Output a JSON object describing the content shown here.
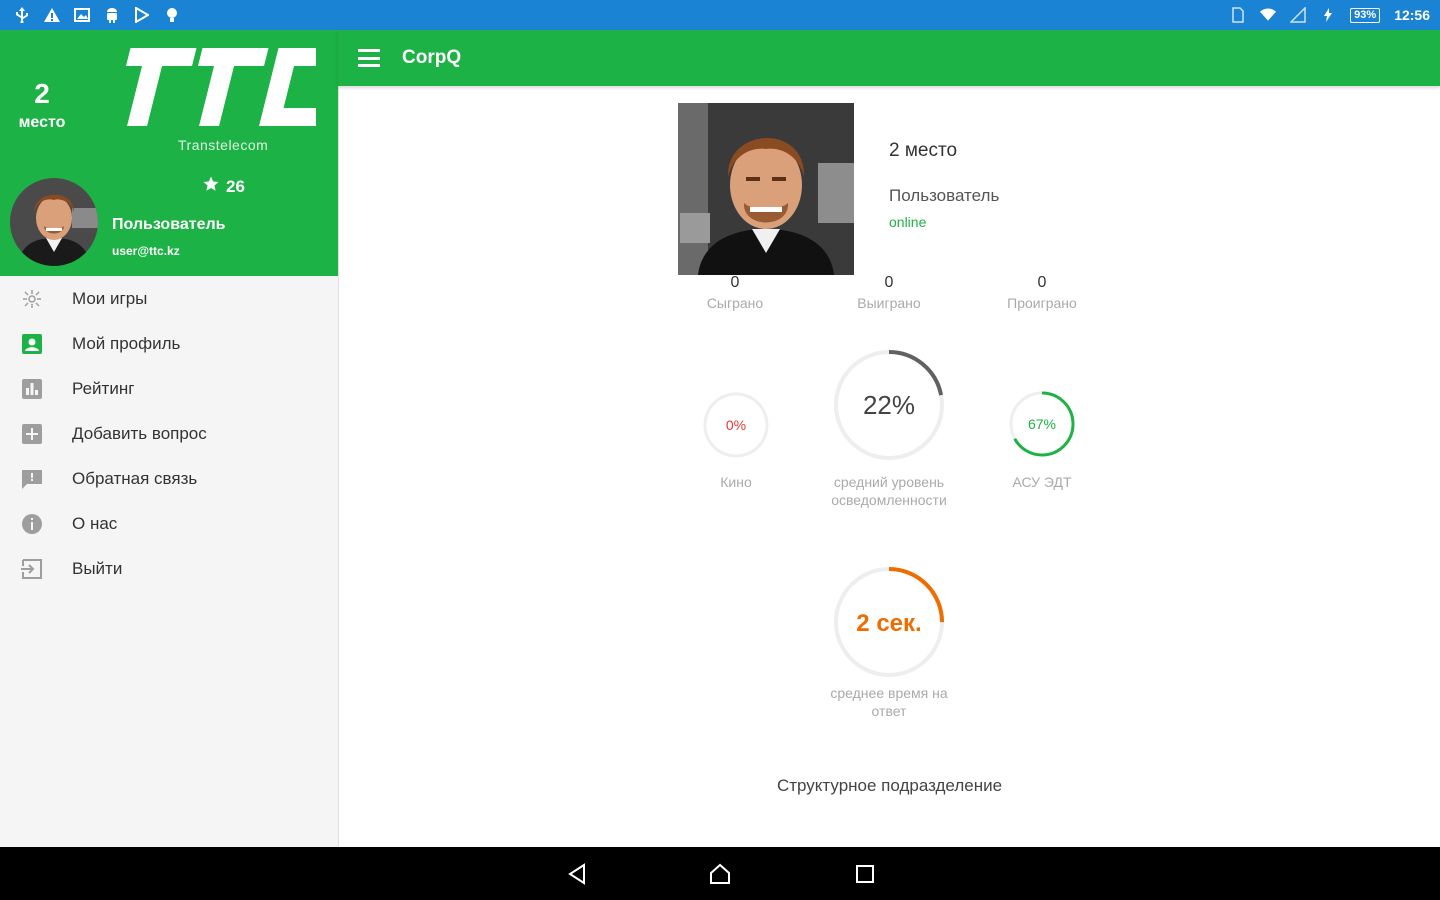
{
  "status_bar": {
    "battery": "93%",
    "time": "12:56",
    "color": "#1a83d4"
  },
  "app": {
    "title": "CorpQ",
    "accent": "#1db245"
  },
  "drawer": {
    "place_number": "2",
    "place_label": "место",
    "logo_subtitle": "Transtelecom",
    "logo_text": "TTC",
    "stars": "26",
    "user_name": "Пользователь",
    "user_email": "user@ttc.kz",
    "menu": [
      {
        "label": "Мои игры",
        "icon": "games-icon"
      },
      {
        "label": "Мой профиль",
        "icon": "profile-icon"
      },
      {
        "label": "Рейтинг",
        "icon": "rating-icon"
      },
      {
        "label": "Добавить вопрос",
        "icon": "add-question-icon"
      },
      {
        "label": "Обратная связь",
        "icon": "feedback-icon"
      },
      {
        "label": "О нас",
        "icon": "info-icon"
      },
      {
        "label": "Выйти",
        "icon": "exit-icon"
      }
    ]
  },
  "profile": {
    "place": "2 место",
    "role": "Пользователь",
    "status": "online",
    "stats": [
      {
        "value": "0",
        "label": "Сыграно"
      },
      {
        "value": "0",
        "label": "Выиграно"
      },
      {
        "value": "0",
        "label": "Проиграно"
      }
    ]
  },
  "gauges": {
    "kino": {
      "value_text": "0%",
      "fraction": 0.0,
      "label": "Кино",
      "color": "#e53935"
    },
    "awareness": {
      "value_text": "22%",
      "fraction": 0.22,
      "label_line1": "средний уровень",
      "label_line2": "осведомленности",
      "color": "#616161"
    },
    "asu": {
      "value_text": "67%",
      "fraction": 0.67,
      "label": "АСУ ЭДТ",
      "color": "#1db245"
    },
    "answer_time": {
      "value_text": "2 сек.",
      "fraction": 0.25,
      "label_line1": "среднее время на",
      "label_line2": "ответ",
      "color": "#ef6c00"
    }
  },
  "department_label": "Структурное подразделение"
}
